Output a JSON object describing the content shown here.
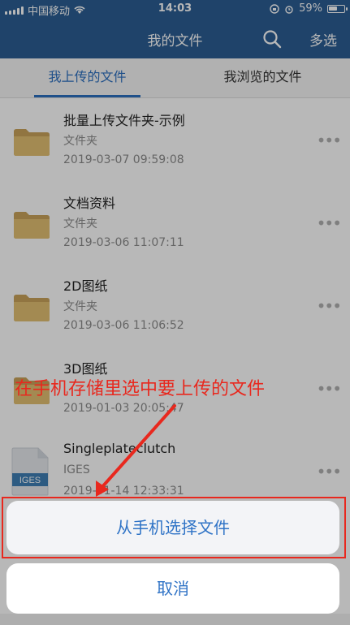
{
  "status": {
    "carrier": "中国移动",
    "time": "14:03",
    "battery": "59%"
  },
  "header": {
    "title": "我的文件",
    "multi_select": "多选",
    "search_icon": "search-icon"
  },
  "tabs": [
    {
      "label": "我上传的文件",
      "active": true
    },
    {
      "label": "我浏览的文件",
      "active": false
    }
  ],
  "files": [
    {
      "name": "批量上传文件夹-示例",
      "type": "文件夹",
      "date": "2019-03-07 09:59:08",
      "icon": "folder-icon"
    },
    {
      "name": "文档资料",
      "type": "文件夹",
      "date": "2019-03-06 11:07:11",
      "icon": "folder-icon"
    },
    {
      "name": "2D图纸",
      "type": "文件夹",
      "date": "2019-03-06 11:06:52",
      "icon": "folder-icon"
    },
    {
      "name": "3D图纸",
      "type": "",
      "date": "2019-01-03 20:05:47",
      "icon": "folder-icon"
    },
    {
      "name": "Singleplateclutch",
      "type": "IGES",
      "date": "2019-01-14 12:33:31",
      "icon": "iges-file-icon"
    }
  ],
  "annotation": "在手机存储里选中要上传的文件",
  "action_sheet": {
    "choose": "从手机选择文件",
    "cancel": "取消"
  },
  "colors": {
    "header": "#2c5e93",
    "accent": "#2c6fbf",
    "annotation": "#e8281e"
  }
}
